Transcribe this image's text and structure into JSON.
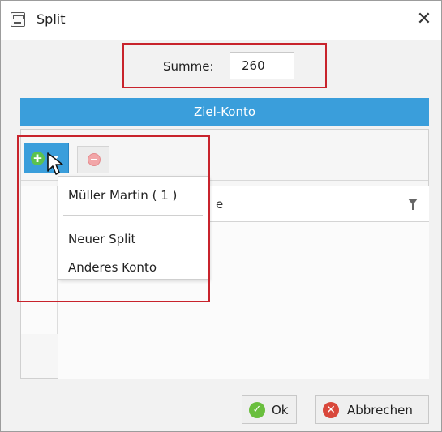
{
  "window": {
    "title": "Split",
    "close_glyph": "✕"
  },
  "summe": {
    "label": "Summe:",
    "value": "260"
  },
  "section": {
    "header": "Ziel-Konto"
  },
  "grid": {
    "column_header_partial": "e",
    "add_icon_glyph": "+"
  },
  "dropdown": {
    "items": [
      {
        "label": "Müller Martin ( 1 )"
      },
      {
        "label": "Neuer Split"
      },
      {
        "label": "Anderes Konto"
      }
    ]
  },
  "footer": {
    "ok_label": "Ok",
    "ok_icon_glyph": "✓",
    "cancel_label": "Abbrechen",
    "cancel_icon_glyph": "✕"
  },
  "colors": {
    "accent": "#3a9edb",
    "highlight": "#c8232c",
    "add_green": "#5cc24f",
    "cancel_red": "#d9483b"
  },
  "icons": {
    "app": "window-app-icon",
    "close": "close-icon",
    "add": "add-circle-icon",
    "dropdown": "chevron-down-icon",
    "remove": "remove-circle-icon",
    "filter": "filter-icon",
    "ok": "check-circle-icon",
    "cancel": "cancel-circle-icon",
    "cursor": "mouse-cursor-icon"
  }
}
